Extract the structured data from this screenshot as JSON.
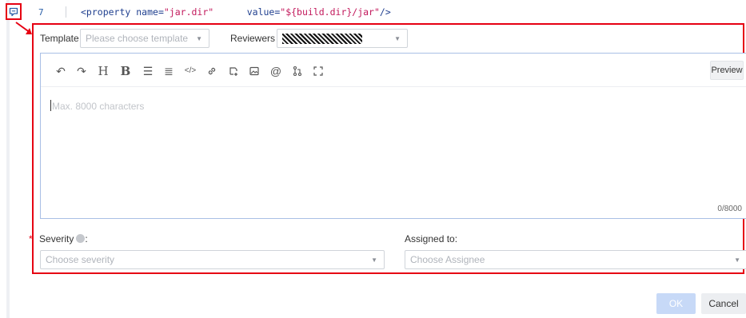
{
  "code": {
    "line_number": "7",
    "tag_open": "<property ",
    "attr_name": "name=",
    "attr_name_value": "\"jar.dir\"",
    "attr_value": "value=",
    "attr_value_value": "\"${build.dir}/jar\"",
    "tag_close": "/>"
  },
  "form": {
    "template_label": "Template",
    "template_placeholder": "Please choose template",
    "reviewers_label": "Reviewers",
    "editor": {
      "placeholder": "Max. 8000 characters",
      "char_count": "0/8000",
      "preview_label": "Preview",
      "toolbar_icons": [
        "undo-icon",
        "redo-icon",
        "heading-icon",
        "bold-icon",
        "bullet-list-icon",
        "ordered-list-icon",
        "code-icon",
        "link-icon",
        "attachment-icon",
        "image-icon",
        "mention-icon",
        "merge-request-icon",
        "fullscreen-icon"
      ]
    },
    "severity_label": "Severity",
    "severity_colon": ":",
    "severity_placeholder": "Choose severity",
    "assigned_label": "Assigned to",
    "assigned_colon": ":",
    "assigned_placeholder": "Choose Assignee",
    "required_mark": "*"
  },
  "actions": {
    "ok_label": "OK",
    "cancel_label": "Cancel"
  },
  "colors": {
    "highlight_border": "#e60012",
    "accent_blue": "#2a5fa8",
    "ok_disabled": "#c7d9f7"
  }
}
